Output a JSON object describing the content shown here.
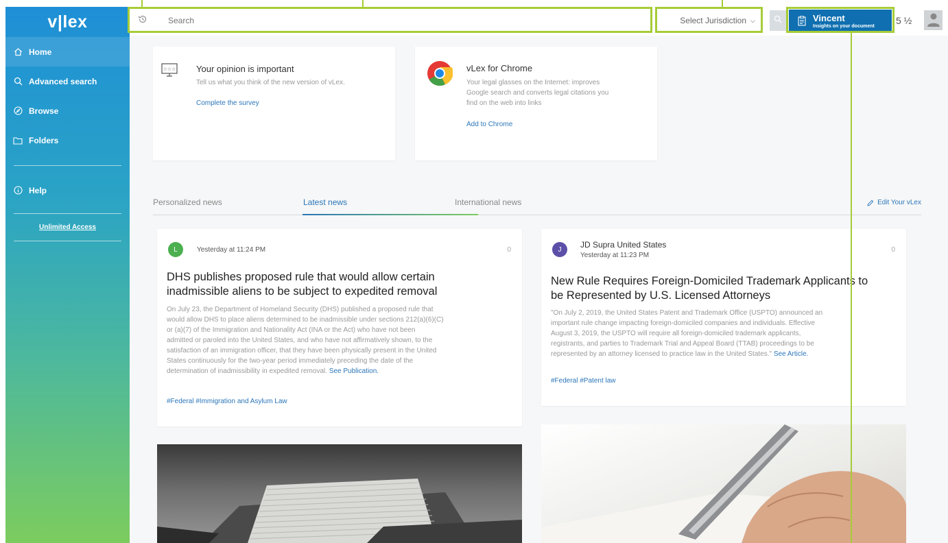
{
  "sidebar": {
    "logo": "v|lex",
    "items": [
      {
        "label": "Home",
        "icon": "home-icon"
      },
      {
        "label": "Advanced search",
        "icon": "search-icon"
      },
      {
        "label": "Browse",
        "icon": "compass-icon"
      },
      {
        "label": "Folders",
        "icon": "folder-icon"
      },
      {
        "label": "Help",
        "icon": "info-icon"
      }
    ],
    "unlimited": "Unlimited Access"
  },
  "topbar": {
    "search_placeholder": "Search",
    "jurisdiction": "Select Jurisdiction",
    "vincent_title": "Vincent",
    "vincent_sub": "Insights on your document",
    "lang": "5 ½"
  },
  "promos": {
    "opinion": {
      "title": "Your opinion is important",
      "text": "Tell us what you think of the new version of vLex.",
      "link": "Complete the survey"
    },
    "chrome": {
      "title": "vLex for Chrome",
      "text_lines": [
        "Your legal glasses on the Internet: improves",
        "Google search and converts legal citations you",
        "find on the web into links"
      ],
      "link": "Add to Chrome"
    }
  },
  "tabs": {
    "personalized": "Personalized news",
    "latest": "Latest news",
    "international": "International news",
    "edit": "Edit Your vLex"
  },
  "news": [
    {
      "badge": "L",
      "badge_color": "#4caf50",
      "source": "",
      "time": "Yesterday at 11:24 PM",
      "count": "0",
      "headline_lines": [
        "DHS publishes proposed rule that would allow certain",
        "inadmissible aliens to be subject to expedited removal"
      ],
      "body_lines": [
        "On July 23, the Department of Homeland Security (DHS) published a proposed rule that",
        "would allow DHS to place aliens determined to be inadmissible under sections 212(a)(6)(C)",
        "or (a)(7) of the Immigration and Nationality Act (INA or the Act) who have not been",
        "admitted or paroled into the United States, and who have not affirmatively shown, to the",
        "satisfaction of an immigration officer, that they have been physically present in the United",
        "States continuously for the two-year period immediately preceding the date of the",
        "determination of inadmissibility in expedited removal."
      ],
      "see": "See Publication.",
      "tags": [
        "#Federal",
        "#Immigration and Asylum Law"
      ]
    },
    {
      "badge": "J",
      "badge_color": "#5c4fa8",
      "source": "JD Supra United States",
      "time": "Yesterday at 11:23 PM",
      "count": "0",
      "headline_lines": [
        "New Rule Requires Foreign-Domiciled Trademark Applicants to",
        "be Represented by U.S. Licensed Attorneys"
      ],
      "body_lines": [
        "\"On July 2, 2019, the United States Patent and Trademark Office (USPTO) announced an",
        "important rule change impacting foreign-domiciled companies and individuals. Effective",
        "August 3, 2019, the USPTO will require all foreign-domiciled trademark applicants,",
        "registrants, and parties to Trademark Trial and Appeal Board (TTAB) proceedings to be",
        "represented by an attorney licensed to practice law in the United States.\""
      ],
      "see": "See Article.",
      "tags": [
        "#Federal",
        "#Patent law"
      ]
    }
  ],
  "colors": {
    "accent": "#2b76b9",
    "highlight": "#a6cc38",
    "vincent": "#0f6fb0"
  }
}
